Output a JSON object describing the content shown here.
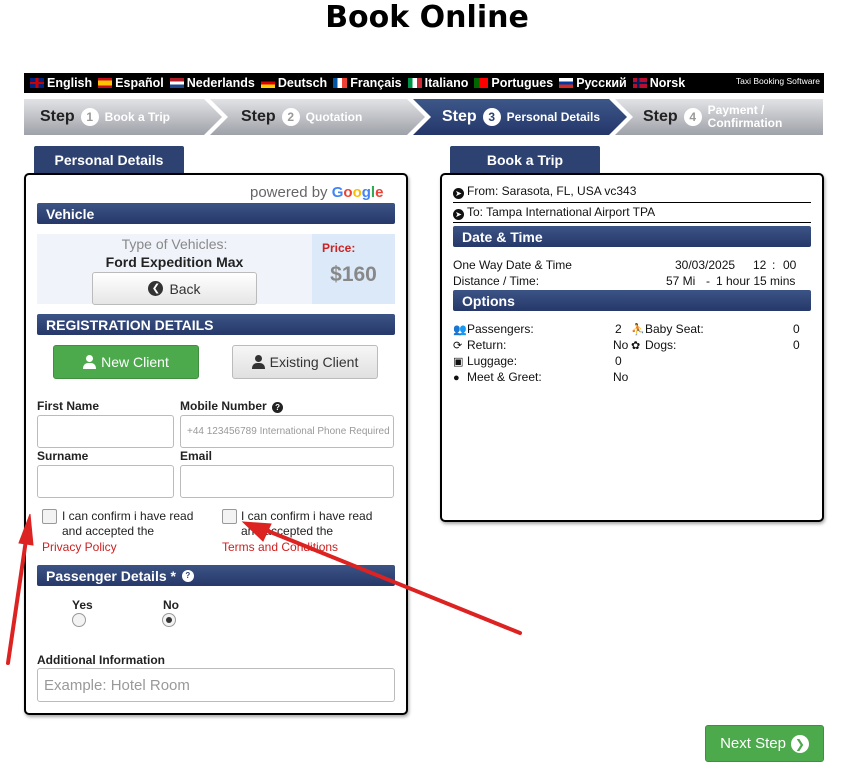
{
  "page": {
    "title": "Book Online"
  },
  "languages": [
    {
      "name": "English",
      "flag": "uk"
    },
    {
      "name": "Español",
      "flag": "es"
    },
    {
      "name": "Nederlands",
      "flag": "nl"
    },
    {
      "name": "Deutsch",
      "flag": "de"
    },
    {
      "name": "Français",
      "flag": "fr"
    },
    {
      "name": "Italiano",
      "flag": "it"
    },
    {
      "name": "Portugues",
      "flag": "pt"
    },
    {
      "name": "Русский",
      "flag": "ru"
    },
    {
      "name": "Norsk",
      "flag": "no"
    }
  ],
  "brand": "Taxi Booking Software",
  "steps": [
    {
      "word": "Step",
      "num": "1",
      "label": "Book a Trip",
      "state": "done"
    },
    {
      "word": "Step",
      "num": "2",
      "label": "Quotation",
      "state": "done"
    },
    {
      "word": "Step",
      "num": "3",
      "label": "Personal Details",
      "state": "active"
    },
    {
      "word": "Step",
      "num": "4",
      "label_line1": "Payment /",
      "label_line2": "Confirmation",
      "state": "pending"
    }
  ],
  "left": {
    "tab": "Personal Details",
    "powered_prefix": "powered by",
    "powered_brand": "Google",
    "vehicle_header": "Vehicle",
    "type_label": "Type of Vehicles:",
    "type_value": "Ford Expedition Max",
    "back_label": "Back",
    "price_label": "Price:",
    "price_value": "$160",
    "registration_header": "REGISTRATION DETAILS",
    "new_client": "New Client",
    "existing_client": "Existing Client",
    "first_name_label": "First Name",
    "mobile_label": "Mobile Number",
    "mobile_placeholder": "+44 123456789 International Phone Required",
    "surname_label": "Surname",
    "email_label": "Email",
    "privacy_text1": "I can confirm i have read",
    "privacy_text2": "and accepted the",
    "privacy_link": "Privacy Policy",
    "terms_text1": "I can confirm i have read",
    "terms_text2": "and accepted the",
    "terms_link": "Terms and Conditions",
    "passenger_header": "Passenger Details *",
    "yes_label": "Yes",
    "no_label": "No",
    "selected": "No",
    "additional_label": "Additional Information",
    "additional_placeholder": "Example: Hotel Room"
  },
  "right": {
    "tab": "Book a Trip",
    "from": "From: Sarasota, FL, USA vc343",
    "to": "To: Tampa International Airport TPA",
    "datetime_header": "Date & Time",
    "date_label": "One Way Date & Time",
    "date_value": "30/03/2025",
    "hour": "12",
    "minute": "00",
    "distance_label": "Distance / Time:",
    "distance_value": "57 Mi",
    "duration_value": "1 hour 15 mins",
    "options_header": "Options",
    "passengers_label": "Passengers:",
    "passengers_value": "2",
    "baby_seat_label": "Baby Seat:",
    "baby_seat_value": "0",
    "return_label": "Return:",
    "return_value": "No",
    "dogs_label": "Dogs:",
    "dogs_value": "0",
    "luggage_label": "Luggage:",
    "luggage_value": "0",
    "meet_label": "Meet & Greet:",
    "meet_value": "No"
  },
  "next_step": "Next Step",
  "colors": {
    "header_blue": "#2d4270",
    "green": "#4caa4c",
    "link_red": "#cc2222",
    "annotation_red": "#dd2222"
  }
}
